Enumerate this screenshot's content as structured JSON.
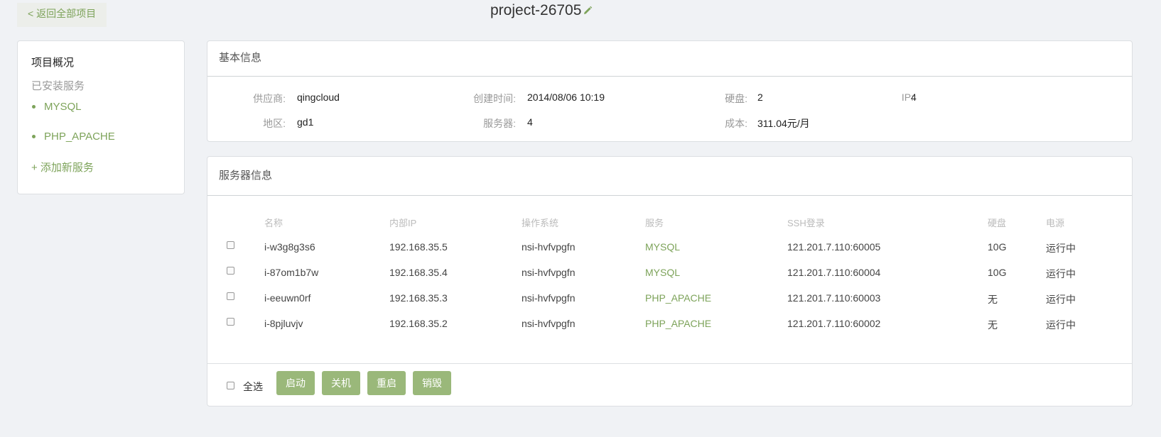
{
  "nav": {
    "back_label": "< 返回全部项目"
  },
  "project": {
    "title": "project-26705"
  },
  "sidebar": {
    "overview": "项目概况",
    "installed_heading": "已安装服务",
    "services": [
      "MYSQL",
      "PHP_APACHE"
    ],
    "add_service": "+ 添加新服务"
  },
  "basic_info": {
    "heading": "基本信息",
    "provider_label": "供应商:",
    "provider": "qingcloud",
    "created_label": "创建时间:",
    "created": "2014/08/06 10:19",
    "disk_label": "硬盘:",
    "disk": "2",
    "ip_label": "IP:",
    "ip": "4",
    "region_label": "地区:",
    "region": "gd1",
    "servers_label": "服务器:",
    "servers": "4",
    "cost_label": "成本:",
    "cost": "311.04元/月"
  },
  "server_info": {
    "heading": "服务器信息",
    "columns": [
      "名称",
      "内部IP",
      "操作系统",
      "服务",
      "SSH登录",
      "硬盘",
      "电源"
    ],
    "rows": [
      [
        "i-w3g8g3s6",
        "192.168.35.5",
        "nsi-hvfvpgfn",
        "MYSQL",
        "121.201.7.110:60005",
        "10G",
        "运行中"
      ],
      [
        "i-87om1b7w",
        "192.168.35.4",
        "nsi-hvfvpgfn",
        "MYSQL",
        "121.201.7.110:60004",
        "10G",
        "运行中"
      ],
      [
        "i-eeuwn0rf",
        "192.168.35.3",
        "nsi-hvfvpgfn",
        "PHP_APACHE",
        "121.201.7.110:60003",
        "无",
        "运行中"
      ],
      [
        "i-8pjluvjv",
        "192.168.35.2",
        "nsi-hvfvpgfn",
        "PHP_APACHE",
        "121.201.7.110:60002",
        "无",
        "运行中"
      ]
    ],
    "select_all": "全选",
    "actions": {
      "start": "启动",
      "shutdown": "关机",
      "restart": "重启",
      "destroy": "销毁"
    }
  },
  "colors": {
    "accent": "#7da35a",
    "button": "#9ab87a",
    "background": "#f0f2f5"
  },
  "icons": {
    "edit": "pencil-icon"
  }
}
